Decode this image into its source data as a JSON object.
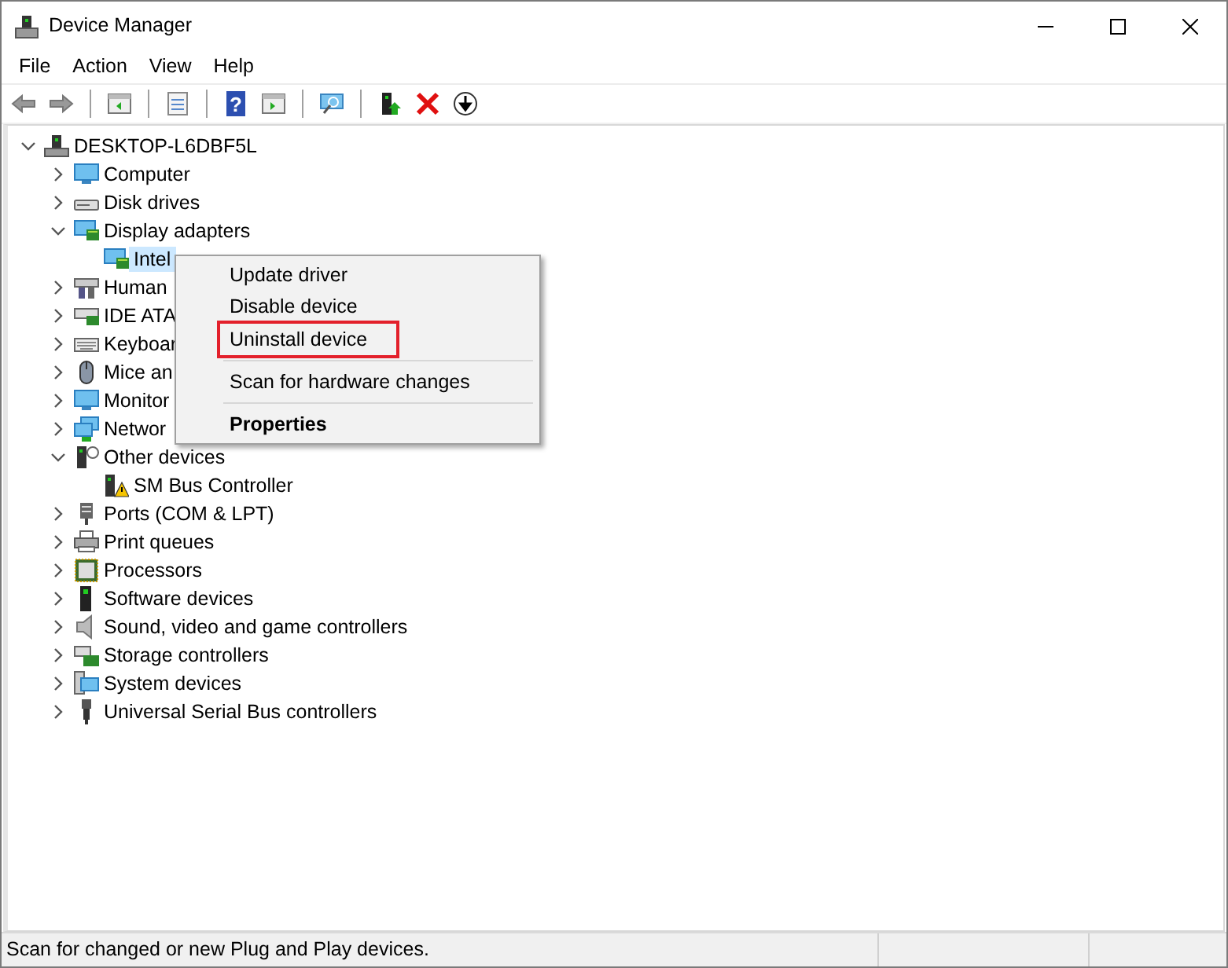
{
  "window": {
    "title": "Device Manager"
  },
  "menu_bar": [
    "File",
    "Action",
    "View",
    "Help"
  ],
  "toolbar": {
    "help_glyph": "?"
  },
  "tree": {
    "label": "DESKTOP-L6DBF5L",
    "expanded": true,
    "selected": false,
    "children": [
      {
        "label": "Computer",
        "expanded": false,
        "selected": false
      },
      {
        "label": "Disk drives",
        "expanded": false,
        "selected": false
      },
      {
        "label": "Display adapters",
        "expanded": true,
        "selected": false,
        "children": [
          {
            "label": "Intel",
            "selected": true
          }
        ]
      },
      {
        "label": "Human",
        "expanded": false,
        "selected": false
      },
      {
        "label": "IDE ATA",
        "expanded": false,
        "selected": false
      },
      {
        "label": "Keyboar",
        "expanded": false,
        "selected": false
      },
      {
        "label": "Mice an",
        "expanded": false,
        "selected": false
      },
      {
        "label": "Monitor",
        "expanded": false,
        "selected": false
      },
      {
        "label": "Networ",
        "expanded": false,
        "selected": false
      },
      {
        "label": "Other devices",
        "expanded": true,
        "selected": false,
        "children": [
          {
            "label": "SM Bus Controller",
            "selected": false
          }
        ]
      },
      {
        "label": "Ports (COM & LPT)",
        "expanded": false,
        "selected": false
      },
      {
        "label": "Print queues",
        "expanded": false,
        "selected": false
      },
      {
        "label": "Processors",
        "expanded": false,
        "selected": false
      },
      {
        "label": "Software devices",
        "expanded": false,
        "selected": false
      },
      {
        "label": "Sound, video and game controllers",
        "expanded": false,
        "selected": false
      },
      {
        "label": "Storage controllers",
        "expanded": false,
        "selected": false
      },
      {
        "label": "System devices",
        "expanded": false,
        "selected": false
      },
      {
        "label": "Universal Serial Bus controllers",
        "expanded": false,
        "selected": false
      }
    ]
  },
  "context_menu": [
    {
      "kind": "item",
      "label": "Update driver",
      "default": false,
      "highlighted": false
    },
    {
      "kind": "item",
      "label": "Disable device",
      "default": false,
      "highlighted": false
    },
    {
      "kind": "item",
      "label": "Uninstall device",
      "default": false,
      "highlighted": true
    },
    {
      "kind": "separator"
    },
    {
      "kind": "item",
      "label": "Scan for hardware changes",
      "default": false,
      "highlighted": false
    },
    {
      "kind": "separator"
    },
    {
      "kind": "item",
      "label": "Properties",
      "default": true,
      "highlighted": false
    }
  ],
  "status_bar": {
    "text": "Scan for changed or new Plug and Play devices."
  }
}
